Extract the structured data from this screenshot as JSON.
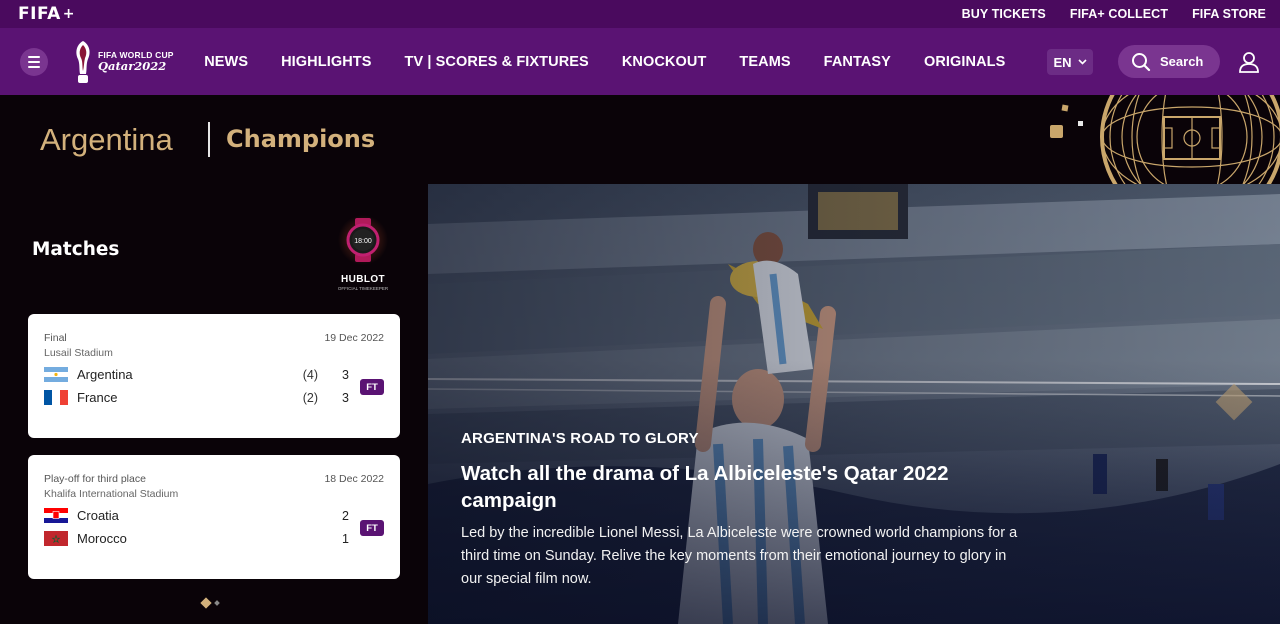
{
  "topbar": {
    "logo_text": "FIFA",
    "logo_plus": "+",
    "links": [
      "BUY TICKETS",
      "FIFA+ COLLECT",
      "FIFA STORE"
    ]
  },
  "nav": {
    "brand_line1": "FIFA WORLD CUP",
    "brand_line2": "Qatar2022",
    "links": [
      "NEWS",
      "HIGHLIGHTS",
      "TV | SCORES & FIXTURES",
      "KNOCKOUT",
      "TEAMS",
      "FANTASY",
      "ORIGINALS"
    ],
    "language": "EN",
    "search_label": "Search"
  },
  "header": {
    "team": "Argentina",
    "status": "Champions"
  },
  "matches": {
    "title": "Matches",
    "sponsor": "HUBLOT",
    "sponsor_sub": "OFFICIAL TIMEKEEPER",
    "watch_time": "18:00",
    "cards": [
      {
        "round": "Final",
        "date": "19 Dec 2022",
        "stadium": "Lusail Stadium",
        "teams": [
          {
            "name": "Argentina",
            "pens": "(4)",
            "score": "3"
          },
          {
            "name": "France",
            "pens": "(2)",
            "score": "3"
          }
        ],
        "status": "FT"
      },
      {
        "round": "Play-off for third place",
        "date": "18 Dec 2022",
        "stadium": "Khalifa International Stadium",
        "teams": [
          {
            "name": "Croatia",
            "pens": "",
            "score": "2"
          },
          {
            "name": "Morocco",
            "pens": "",
            "score": "1"
          }
        ],
        "status": "FT"
      }
    ]
  },
  "hero": {
    "kicker": "ARGENTINA'S ROAD TO GLORY",
    "title": "Watch all the drama of La Albiceleste's Qatar 2022 campaign",
    "description": "Led by the incredible Lionel Messi, La Albiceleste were crowned world champions for a third time on Sunday. Relive the key moments from their emotional journey to glory in our special film now."
  },
  "colors": {
    "topbar": "#4a0a5e",
    "nav": "#5a1373",
    "gold": "#d3b17c",
    "badge": "#5a1373"
  }
}
